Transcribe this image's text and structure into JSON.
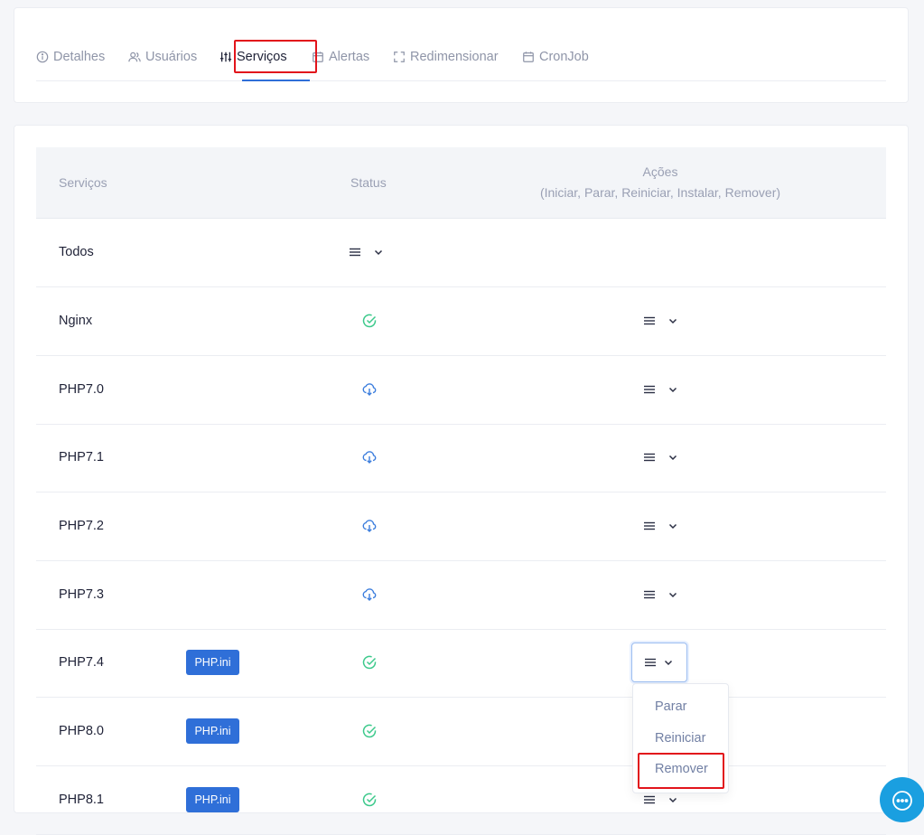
{
  "tabs": [
    {
      "label": "Detalhes",
      "icon": "info-icon"
    },
    {
      "label": "Usuários",
      "icon": "users-icon"
    },
    {
      "label": "Serviços",
      "icon": "sliders-icon"
    },
    {
      "label": "Alertas",
      "icon": "calendar-icon"
    },
    {
      "label": "Redimensionar",
      "icon": "resize-icon"
    },
    {
      "label": "CronJob",
      "icon": "calendar-icon"
    }
  ],
  "active_tab": "Serviços",
  "table": {
    "headers": {
      "services": "Serviços",
      "status": "Status",
      "actions": "Ações",
      "actions_sub": "(Iniciar, Parar, Reiniciar, Instalar, Remover)"
    },
    "rows": [
      {
        "name": "Todos",
        "badge": "",
        "status": "menu"
      },
      {
        "name": "Nginx",
        "badge": "",
        "status": "installed"
      },
      {
        "name": "PHP7.0",
        "badge": "",
        "status": "not-installed"
      },
      {
        "name": "PHP7.1",
        "badge": "",
        "status": "not-installed"
      },
      {
        "name": "PHP7.2",
        "badge": "",
        "status": "not-installed"
      },
      {
        "name": "PHP7.3",
        "badge": "",
        "status": "not-installed"
      },
      {
        "name": "PHP7.4",
        "badge": "PHP.ini",
        "status": "installed"
      },
      {
        "name": "PHP8.0",
        "badge": "PHP.ini",
        "status": "installed"
      },
      {
        "name": "PHP8.1",
        "badge": "PHP.ini",
        "status": "installed"
      }
    ]
  },
  "dropdown": {
    "items": [
      "Parar",
      "Reiniciar",
      "Remover"
    ],
    "highlighted": "Remover"
  },
  "colors": {
    "accent": "#2f6fd8",
    "success": "#3cc98b",
    "download": "#3b7ddd",
    "highlight": "#e2141b",
    "fab": "#1a9fe0"
  }
}
